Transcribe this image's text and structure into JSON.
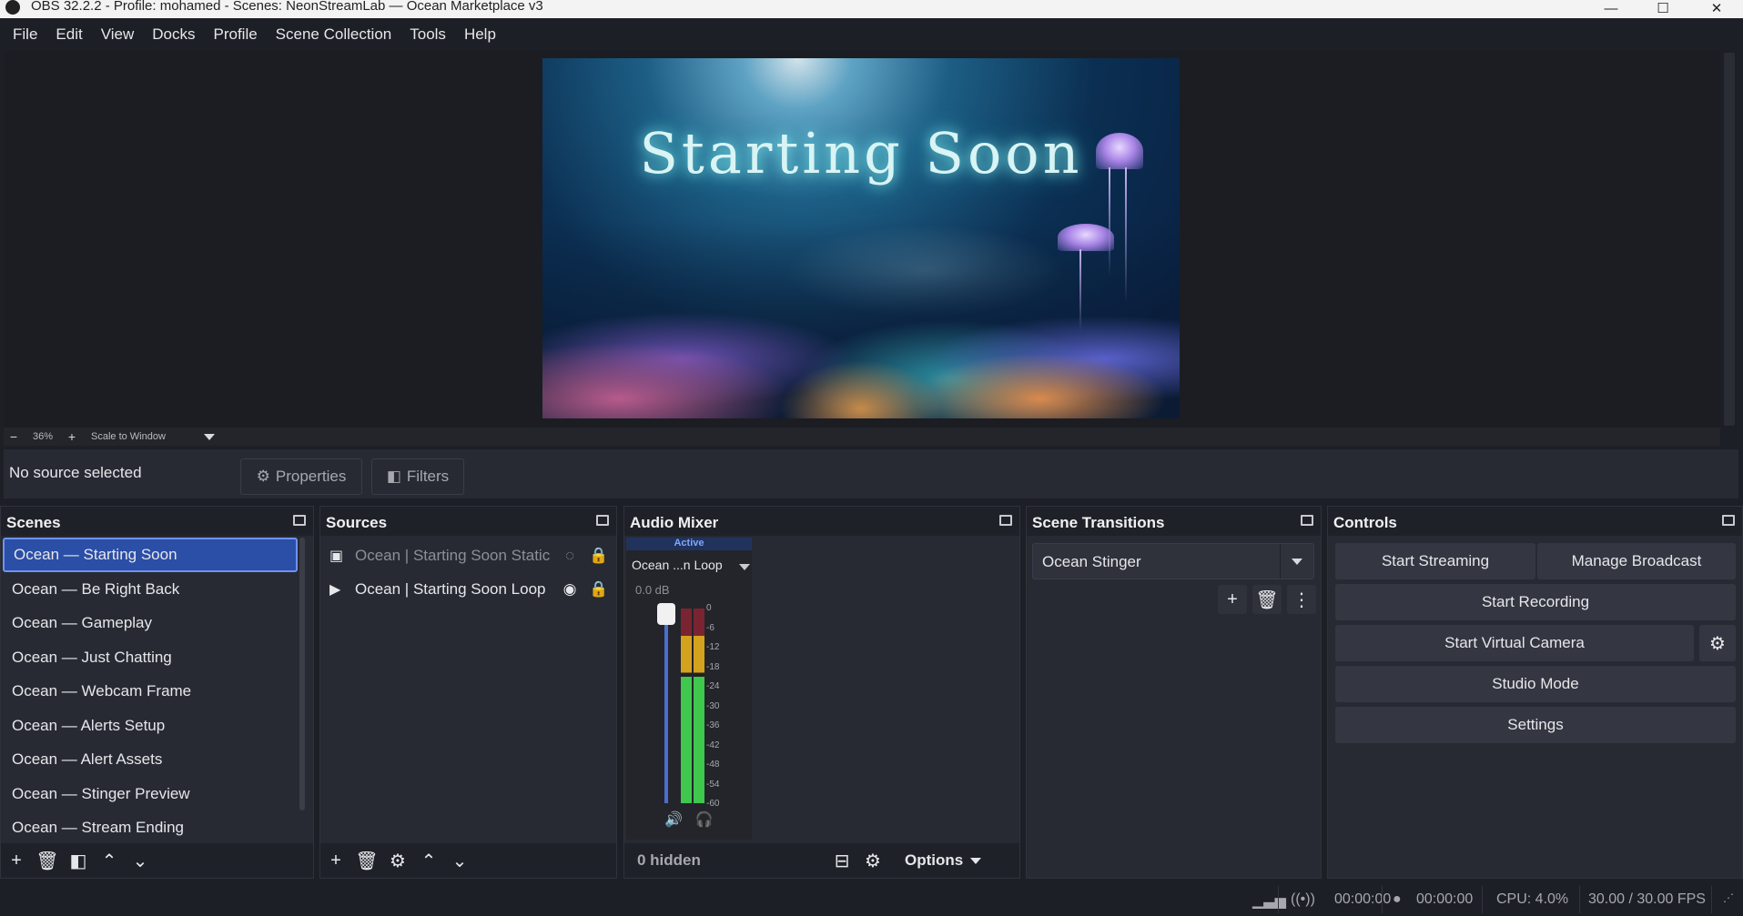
{
  "window": {
    "title": "OBS 32.2.2 - Profile: mohamed - Scenes: NeonStreamLab — Ocean Marketplace v3",
    "minimize": "—",
    "maximize": "☐",
    "close": "✕"
  },
  "menu": [
    "File",
    "Edit",
    "View",
    "Docks",
    "Profile",
    "Scene Collection",
    "Tools",
    "Help"
  ],
  "preview": {
    "overlay_text": "Starting Soon",
    "zoom_minus": "−",
    "zoom_value": "36%",
    "zoom_plus": "+",
    "scale_mode": "Scale to Window"
  },
  "context_bar": {
    "status": "No source selected",
    "properties_label": "Properties",
    "filters_label": "Filters"
  },
  "scenes": {
    "title": "Scenes",
    "items": [
      "Ocean — Starting Soon",
      "Ocean — Be Right Back",
      "Ocean — Gameplay",
      "Ocean — Just Chatting",
      "Ocean — Webcam Frame",
      "Ocean — Alerts Setup",
      "Ocean — Alert Assets",
      "Ocean — Stinger Preview",
      "Ocean — Stream Ending"
    ],
    "selected_index": 0
  },
  "sources": {
    "title": "Sources",
    "items": [
      {
        "name": "Ocean | Starting Soon Static",
        "type_icon": "image-icon",
        "visible": false,
        "locked": true
      },
      {
        "name": "Ocean | Starting Soon Loop",
        "type_icon": "media-play-icon",
        "visible": true,
        "locked": true
      }
    ]
  },
  "audio_mixer": {
    "title": "Audio Mixer",
    "channel": {
      "status": "Active",
      "name": "Ocean ...n Loop",
      "volume": "0.0 dB",
      "ticks": [
        "0",
        "-6",
        "-12",
        "-18",
        "-24",
        "-30",
        "-36",
        "-42",
        "-48",
        "-54",
        "-60"
      ]
    },
    "hidden_label": "0 hidden",
    "options_label": "Options"
  },
  "scene_transitions": {
    "title": "Scene Transitions",
    "selected": "Ocean Stinger"
  },
  "controls": {
    "title": "Controls",
    "start_streaming": "Start Streaming",
    "manage_broadcast": "Manage Broadcast",
    "start_recording": "Start Recording",
    "start_virtual_camera": "Start Virtual Camera",
    "studio_mode": "Studio Mode",
    "settings": "Settings"
  },
  "status_bar": {
    "stream_time": "00:00:00",
    "record_time": "00:00:00",
    "cpu": "CPU: 4.0%",
    "fps": "30.00 / 30.00 FPS"
  },
  "colors": {
    "accent": "#2b4ea6",
    "panel": "#272a33",
    "background": "#1d1f26"
  }
}
